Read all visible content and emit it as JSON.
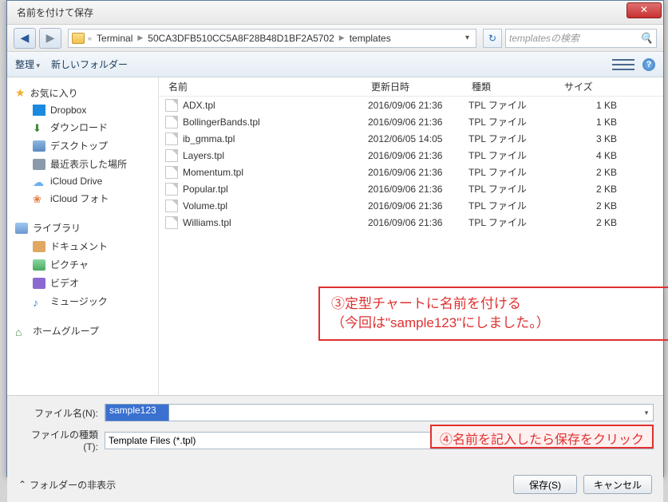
{
  "title": "名前を付けて保存",
  "breadcrumb": {
    "sep1": "«",
    "p1": "Terminal",
    "p2": "50CA3DFB510CC5A8F28B48D1BF2A5702",
    "p3": "templates"
  },
  "search_placeholder": "templatesの検索",
  "toolbar": {
    "organize": "整理",
    "newfolder": "新しいフォルダー"
  },
  "sidebar": {
    "fav": "お気に入り",
    "fav_items": [
      "Dropbox",
      "ダウンロード",
      "デスクトップ",
      "最近表示した場所",
      "iCloud Drive",
      "iCloud フォト"
    ],
    "lib": "ライブラリ",
    "lib_items": [
      "ドキュメント",
      "ピクチャ",
      "ビデオ",
      "ミュージック"
    ],
    "home": "ホームグループ"
  },
  "columns": {
    "name": "名前",
    "date": "更新日時",
    "type": "種類",
    "size": "サイズ"
  },
  "files": [
    {
      "n": "ADX.tpl",
      "d": "2016/09/06 21:36",
      "t": "TPL ファイル",
      "s": "1 KB"
    },
    {
      "n": "BollingerBands.tpl",
      "d": "2016/09/06 21:36",
      "t": "TPL ファイル",
      "s": "1 KB"
    },
    {
      "n": "ib_gmma.tpl",
      "d": "2012/06/05 14:05",
      "t": "TPL ファイル",
      "s": "3 KB"
    },
    {
      "n": "Layers.tpl",
      "d": "2016/09/06 21:36",
      "t": "TPL ファイル",
      "s": "4 KB"
    },
    {
      "n": "Momentum.tpl",
      "d": "2016/09/06 21:36",
      "t": "TPL ファイル",
      "s": "2 KB"
    },
    {
      "n": "Popular.tpl",
      "d": "2016/09/06 21:36",
      "t": "TPL ファイル",
      "s": "2 KB"
    },
    {
      "n": "Volume.tpl",
      "d": "2016/09/06 21:36",
      "t": "TPL ファイル",
      "s": "2 KB"
    },
    {
      "n": "Williams.tpl",
      "d": "2016/09/06 21:36",
      "t": "TPL ファイル",
      "s": "2 KB"
    }
  ],
  "anno1_l1": "③定型チャートに名前を付ける",
  "anno1_l2": "（今回は\"sample123\"にしました。）",
  "anno2": "④名前を記入したら保存をクリック",
  "filename_label": "ファイル名(N):",
  "filename_value": "sample123",
  "filetype_label": "ファイルの種類(T):",
  "filetype_value": "Template Files (*.tpl)",
  "hide_folders": "フォルダーの非表示",
  "save_btn": "保存(S)",
  "cancel_btn": "キャンセル"
}
